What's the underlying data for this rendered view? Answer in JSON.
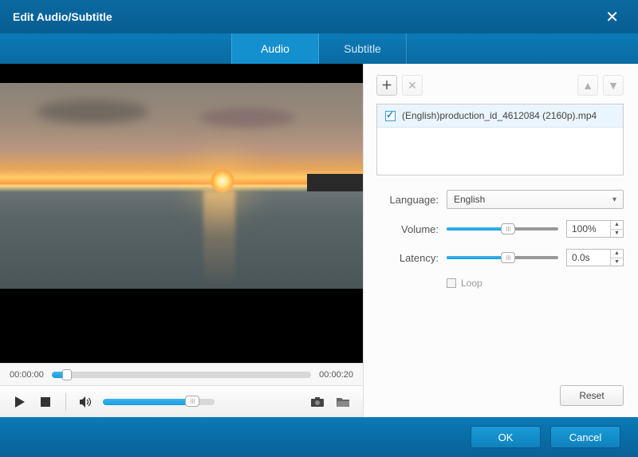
{
  "window": {
    "title": "Edit Audio/Subtitle"
  },
  "tabs": {
    "audio": "Audio",
    "subtitle": "Subtitle"
  },
  "playback": {
    "current_time": "00:00:00",
    "total_time": "00:00:20"
  },
  "tracks": {
    "item0": "(English)production_id_4612084 (2160p).mp4"
  },
  "form": {
    "language_label": "Language:",
    "language_value": "English",
    "volume_label": "Volume:",
    "volume_value": "100%",
    "latency_label": "Latency:",
    "latency_value": "0.0s",
    "loop_label": "Loop"
  },
  "buttons": {
    "reset": "Reset",
    "ok": "OK",
    "cancel": "Cancel"
  }
}
